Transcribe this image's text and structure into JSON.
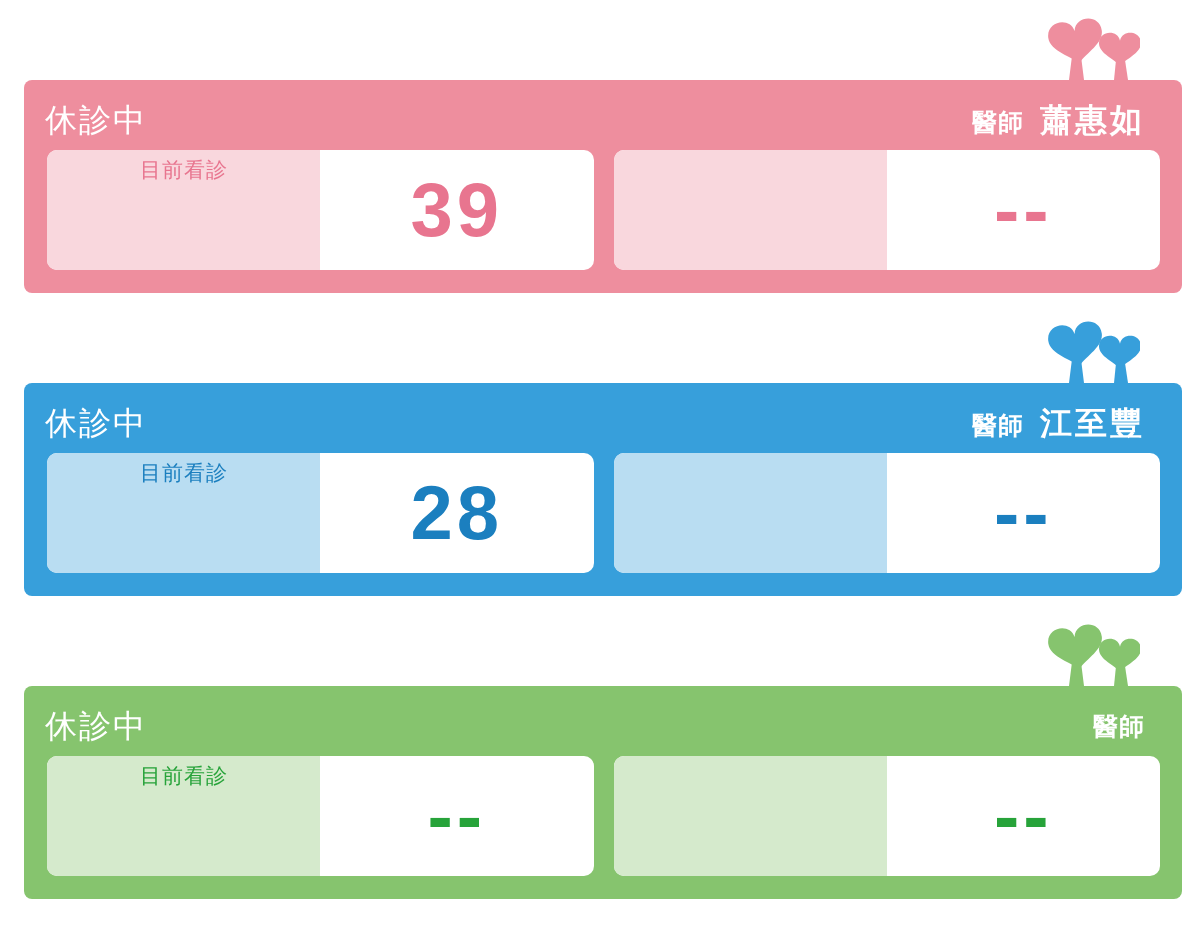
{
  "panels": [
    {
      "color": "#ee8e9e",
      "status": "休診中",
      "doctor_label": "醫師",
      "doctor_name": "蕭惠如",
      "slots": [
        {
          "label": "目前看診",
          "number": "39",
          "color": "#e8758f"
        },
        {
          "number": "--",
          "color": "#e8758f"
        }
      ]
    },
    {
      "color": "#379fdb",
      "status": "休診中",
      "doctor_label": "醫師",
      "doctor_name": "江至豐",
      "slots": [
        {
          "label": "目前看診",
          "number": "28",
          "color": "#1b7fbf"
        },
        {
          "number": "--",
          "color": "#1b7fbf"
        }
      ]
    },
    {
      "color": "#86c46e",
      "status": "休診中",
      "doctor_label": "醫師",
      "slots": [
        {
          "label": "目前看診",
          "number": "--",
          "color": "#27a33a"
        },
        {
          "number": "--",
          "color": "#27a33a"
        }
      ]
    }
  ]
}
